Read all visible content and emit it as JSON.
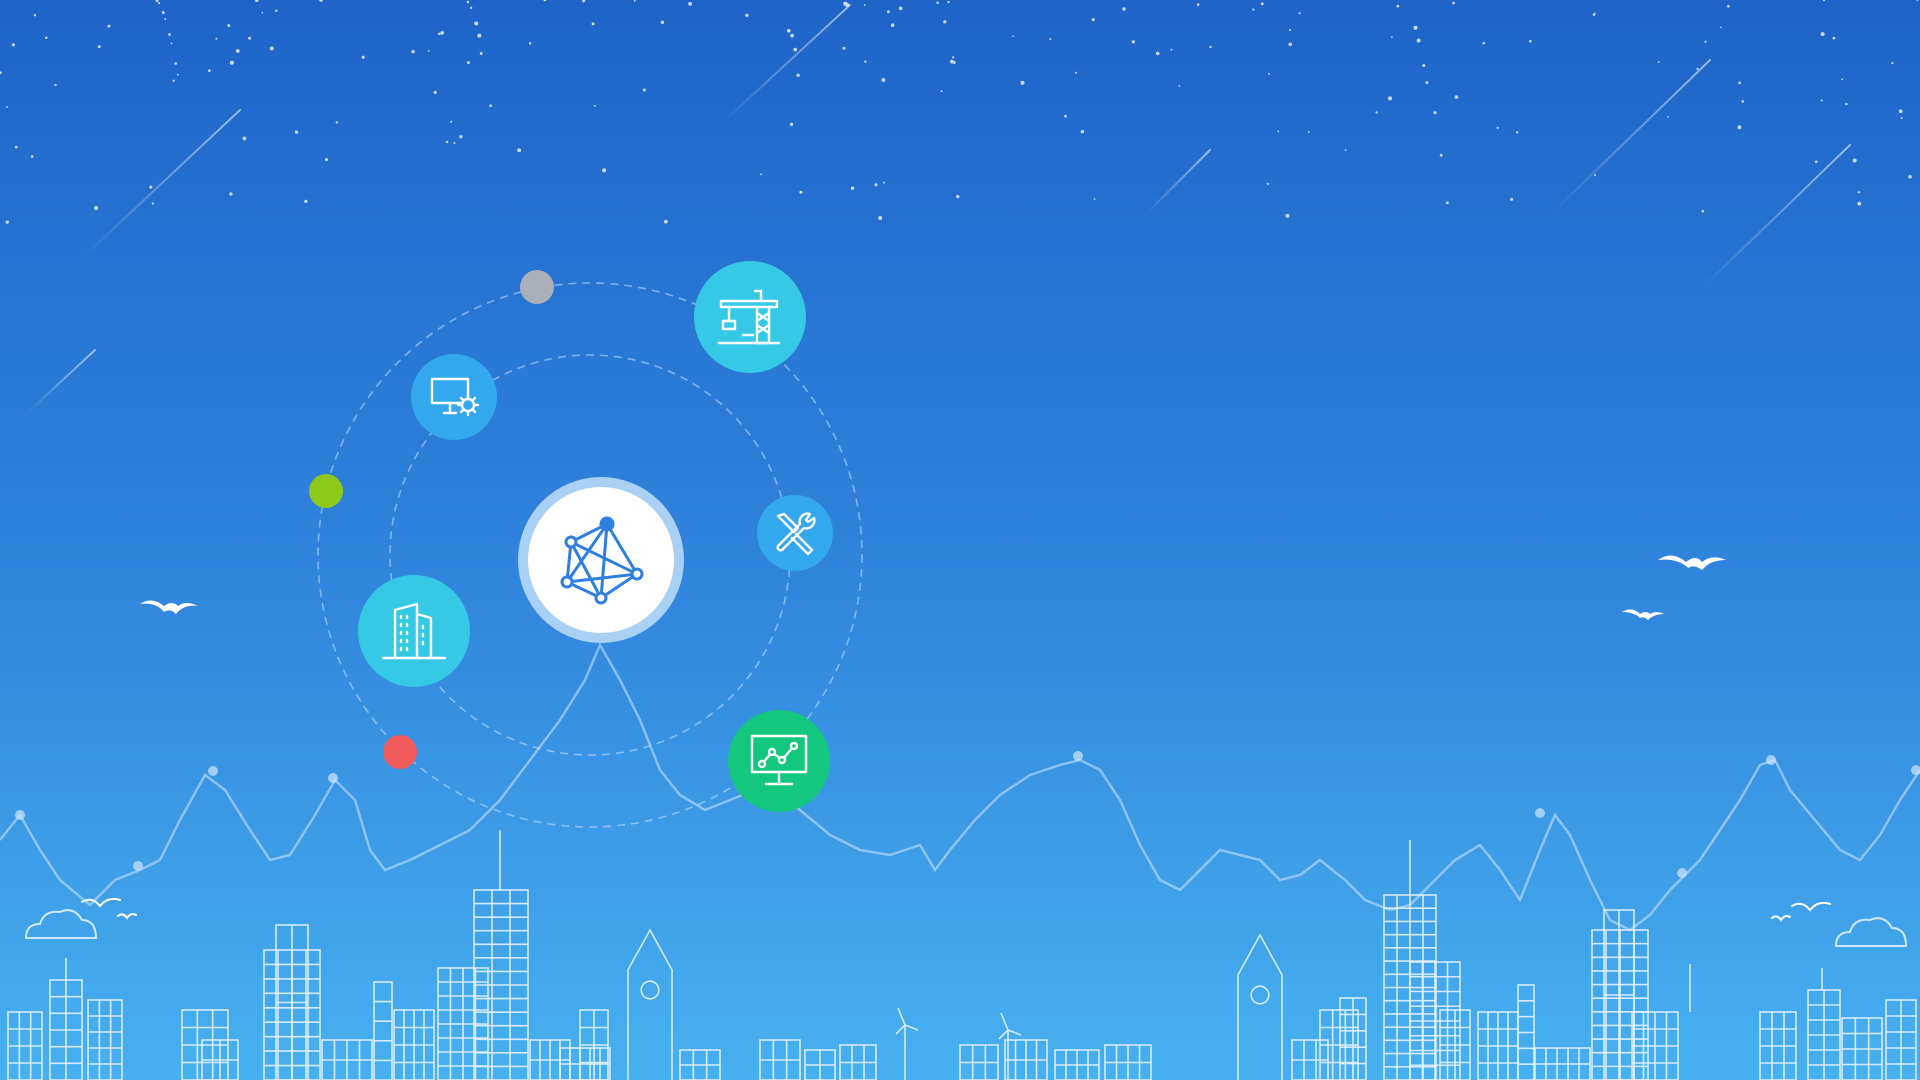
{
  "colors": {
    "sky_top": "#1f63c9",
    "sky_bottom": "#46aef0",
    "node_cyan": "#35c9e6",
    "node_blue": "#33a8ee",
    "node_green": "#14c77e",
    "hub_fill": "#ffffff",
    "hub_ring": "#a9d0f5",
    "hub_icon": "#2f7fe0",
    "dot_gray": "#a9aeb8",
    "dot_green": "#8cc919",
    "dot_red": "#f25b5b",
    "outline": "#dbefff"
  },
  "icons": {
    "hub": "network-mesh-icon",
    "crane": "construction-crane-icon",
    "monitor_settings": "monitor-settings-icon",
    "tools": "wrench-screwdriver-icon",
    "building": "office-building-icon",
    "analytics": "analytics-monitor-icon"
  }
}
